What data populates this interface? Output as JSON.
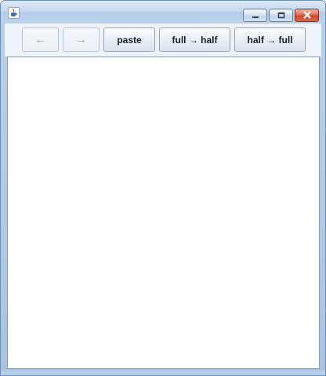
{
  "window": {
    "icon": "java-cup-icon",
    "controls": {
      "minimize": "minimize-icon",
      "maximize": "maximize-icon",
      "close": "close-icon"
    }
  },
  "toolbar": {
    "back_label": "←",
    "forward_label": "→",
    "paste_label": "paste",
    "full_to_half_label": "full → half",
    "half_to_full_label": "half → full"
  },
  "content": {
    "text": ""
  }
}
